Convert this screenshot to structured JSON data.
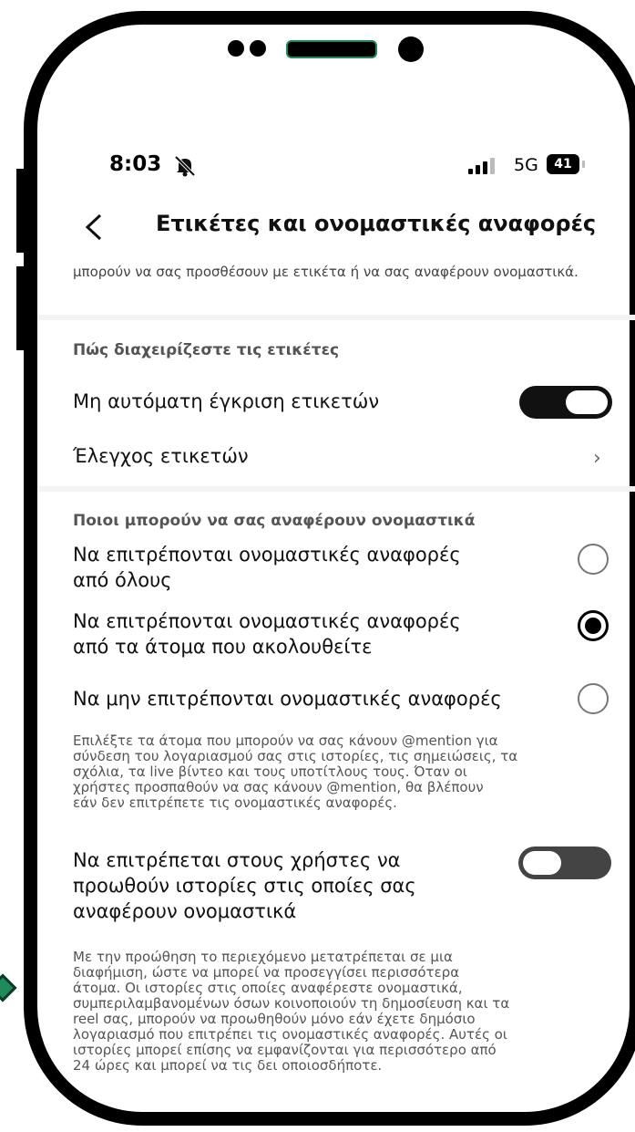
{
  "status_bar": {
    "time": "8:03",
    "network": "5G",
    "battery": "41"
  },
  "header": {
    "title": "Ετικέτες και ονομαστικές αναφορές"
  },
  "intro_text": "μπορούν να σας προσθέσουν με ετικέτα ή να σας αναφέρουν ονομαστικά.",
  "tags_section": {
    "heading": "Πώς διαχειρίζεστε τις ετικέτες",
    "manual_approve_label": "Μη αυτόματη έγκριση ετικετών",
    "manual_approve_on": true,
    "review_tags_label": "Έλεγχος ετικετών"
  },
  "mentions_section": {
    "heading": "Ποιοι μπορούν να σας αναφέρουν ονομαστικά",
    "options": [
      {
        "label_line1": "Να επιτρέπονται ονομαστικές αναφορές",
        "label_line2": "από όλους",
        "selected": false
      },
      {
        "label_line1": "Να επιτρέπονται ονομαστικές αναφορές",
        "label_line2": "από τα άτομα που ακολουθείτε",
        "selected": true
      },
      {
        "label_line1": "Να μην επιτρέπονται ονομαστικές αναφορές",
        "label_line2": "",
        "selected": false
      }
    ],
    "description": [
      "Επιλέξτε τα άτομα που μπορούν να σας κάνουν @mention για",
      "σύνδεση του λογαριασμού σας στις ιστορίες, τις σημειώσεις, τα",
      "σχόλια, τα live βίντεο και τους υποτίτλους τους. Όταν οι",
      "χρήστες προσπαθούν να σας κάνουν @mention, θα βλέπουν",
      "εάν δεν επιτρέπετε τις ονομαστικές αναφορές."
    ]
  },
  "promote_section": {
    "label": [
      "Να επιτρέπεται στους χρήστες να",
      "προωθούν ιστορίες στις οποίες σας",
      "αναφέρουν ονομαστικά"
    ],
    "toggle_on": false,
    "description": [
      "Με την προώθηση το περιεχόμενο μετατρέπεται σε μια",
      "διαφήμιση, ώστε να μπορεί να προσεγγίσει περισσότερα",
      "άτομα. Οι ιστορίες στις οποίες αναφέρεστε ονομαστικά,",
      "συμπεριλαμβανομένων όσων κοινοποιούν τη δημοσίευση και τα",
      "reel σας, μπορούν να προωθηθούν μόνο εάν έχετε δημόσιο",
      "λογαριασμό που επιτρέπει τις ονομαστικές αναφορές. Αυτές οι",
      "ιστορίες μπορεί επίσης να εμφανίζονται για περισσότερο από",
      "24 ώρες και μπορεί να τις δει οποιοσδήποτε."
    ]
  },
  "icons": {
    "back": "chevron-left-icon",
    "bell": "bell-slash-icon",
    "chevron": "chevron-right-icon"
  }
}
